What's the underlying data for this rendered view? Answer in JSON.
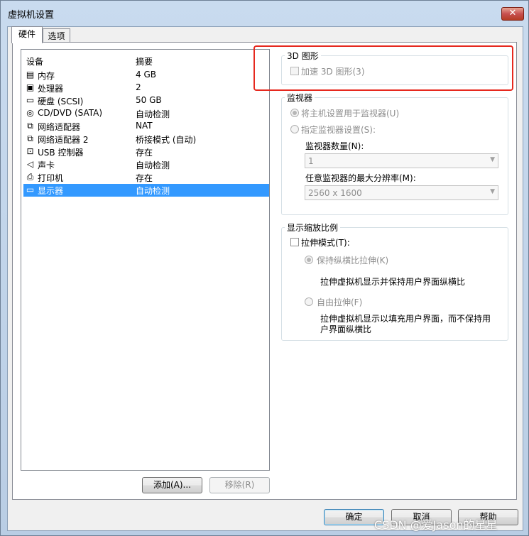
{
  "window": {
    "title": "虚拟机设置",
    "close_glyph": "✕"
  },
  "tabs": [
    {
      "label": "硬件"
    },
    {
      "label": "选项"
    }
  ],
  "device_list": {
    "headers": {
      "device": "设备",
      "summary": "摘要"
    },
    "rows": [
      {
        "name": "内存",
        "summary": "4 GB",
        "icon": "memory-icon"
      },
      {
        "name": "处理器",
        "summary": "2",
        "icon": "processor-icon"
      },
      {
        "name": "硬盘 (SCSI)",
        "summary": "50 GB",
        "icon": "harddisk-icon"
      },
      {
        "name": "CD/DVD (SATA)",
        "summary": "自动检测",
        "icon": "cd-dvd-icon"
      },
      {
        "name": "网络适配器",
        "summary": "NAT",
        "icon": "network-icon"
      },
      {
        "name": "网络适配器 2",
        "summary": "桥接模式 (自动)",
        "icon": "network-icon"
      },
      {
        "name": "USB 控制器",
        "summary": "存在",
        "icon": "usb-icon"
      },
      {
        "name": "声卡",
        "summary": "自动检测",
        "icon": "sound-icon"
      },
      {
        "name": "打印机",
        "summary": "存在",
        "icon": "printer-icon"
      },
      {
        "name": "显示器",
        "summary": "自动检测",
        "icon": "monitor-icon",
        "selected": true
      }
    ]
  },
  "buttons": {
    "add": "添加(A)...",
    "remove": "移除(R)",
    "ok": "确定",
    "cancel": "取消",
    "help": "帮助"
  },
  "graphics_3d": {
    "title": "3D 图形",
    "accelerate_label": "加速 3D 图形(3)",
    "checked": false,
    "disabled": true
  },
  "monitor": {
    "title": "监视器",
    "use_host_label": "将主机设置用于监视器(U)",
    "specify_label": "指定监视器设置(S):",
    "count_label": "监视器数量(N):",
    "count_value": "1",
    "max_res_label": "任意监视器的最大分辨率(M):",
    "max_res_value": "2560 x 1600"
  },
  "scaling": {
    "title": "显示缩放比例",
    "stretch_label": "拉伸模式(T):",
    "keep_aspect_label": "保持纵横比拉伸(K)",
    "keep_aspect_desc": "拉伸虚拟机显示并保持用户界面纵横比",
    "free_label": "自由拉伸(F)",
    "free_desc_1": "拉伸虚拟机显示以填充用户界面，而不保持用",
    "free_desc_2": "户界面纵横比"
  },
  "watermark": "CSDN @爱Jason的星星",
  "colors": {
    "selection": "#3399ff",
    "highlight_box": "#e6281e"
  }
}
